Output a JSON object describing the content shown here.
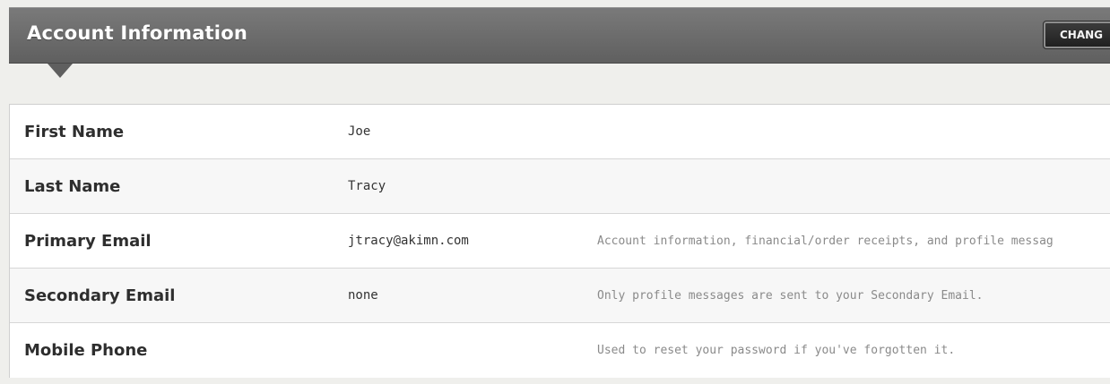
{
  "header": {
    "title": "Account Information",
    "change_button_label": "CHANG"
  },
  "colors": {
    "header_bar": "#6a6a6a",
    "change_button": "#2a2a2a",
    "row_alt": "#f7f7f7",
    "label_text": "#2e2e2e",
    "note_text": "#8a8a8a"
  },
  "account_rows": [
    {
      "label": "First Name",
      "value": "Joe",
      "note": ""
    },
    {
      "label": "Last Name",
      "value": "Tracy",
      "note": ""
    },
    {
      "label": "Primary Email",
      "value": "jtracy@akimn.com",
      "note": "Account information, financial/order receipts, and profile messag"
    },
    {
      "label": "Secondary Email",
      "value": "none",
      "note": "Only profile messages are sent to your Secondary Email."
    },
    {
      "label": "Mobile Phone",
      "value": "",
      "note": "Used to reset your password if you've forgotten it."
    }
  ]
}
